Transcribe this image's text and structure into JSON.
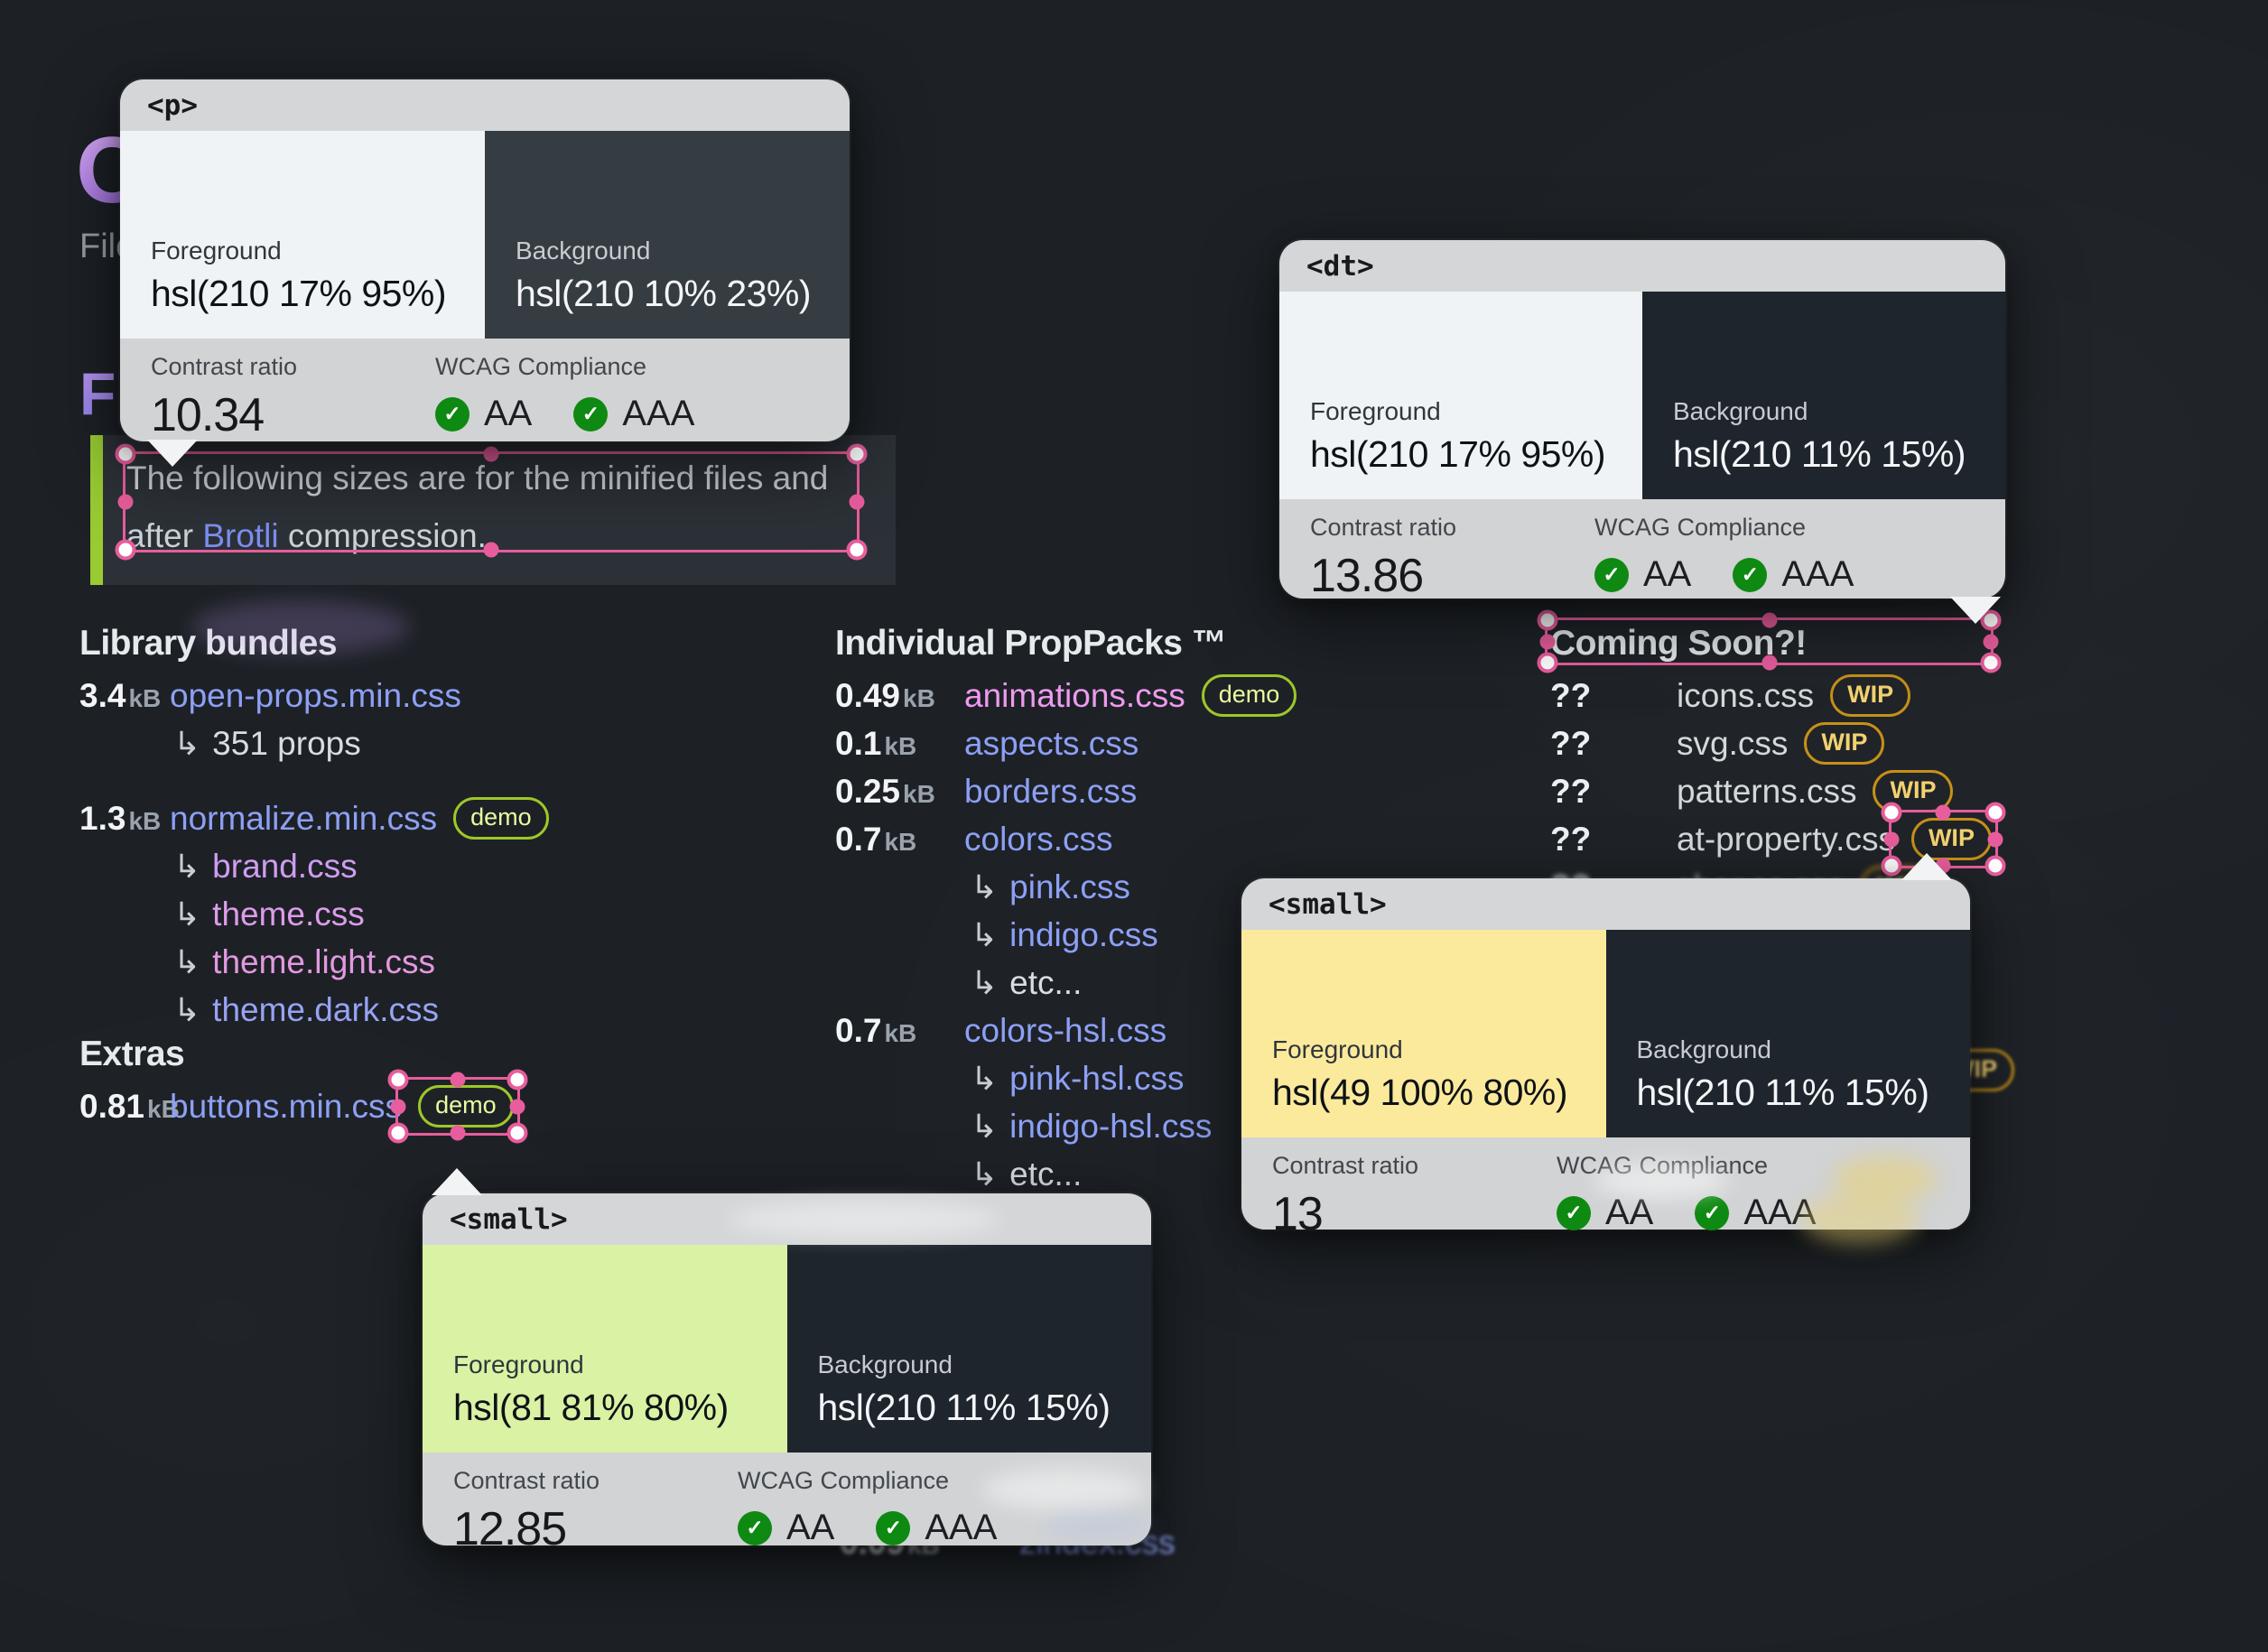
{
  "hero": {
    "big_letter": "O",
    "clipped_word": "File",
    "clipped_heading": "Fi"
  },
  "note": {
    "line1": "The following sizes are for the minified files and",
    "line2_before": "after ",
    "line2_link": "Brotli",
    "line2_after": " compression."
  },
  "columns": {
    "library": {
      "heading": "Library bundles",
      "rows": [
        {
          "size": "3.4",
          "unit": "kB",
          "name": "open-props.min.css"
        },
        {
          "arrow": "↳",
          "name": "351 props"
        },
        {
          "size": "1.3",
          "unit": "kB",
          "name": "normalize.min.css",
          "badge": "demo"
        },
        {
          "arrow": "↳",
          "name": "brand.css"
        },
        {
          "arrow": "↳",
          "name": "theme.css"
        },
        {
          "arrow": "↳",
          "name": "theme.light.css"
        },
        {
          "arrow": "↳",
          "name": "theme.dark.css"
        }
      ]
    },
    "extras": {
      "heading": "Extras",
      "rows": [
        {
          "size": "0.81",
          "unit": "kB",
          "name": "buttons.min.css",
          "badge": "demo"
        }
      ]
    },
    "packs": {
      "heading": "Individual PropPacks ™",
      "rows": [
        {
          "size": "0.49",
          "unit": "kB",
          "name": "animations.css",
          "badge": "demo"
        },
        {
          "size": "0.1",
          "unit": "kB",
          "name": "aspects.css"
        },
        {
          "size": "0.25",
          "unit": "kB",
          "name": "borders.css"
        },
        {
          "size": "0.7",
          "unit": "kB",
          "name": "colors.css"
        },
        {
          "arrow": "↳",
          "name": "pink.css"
        },
        {
          "arrow": "↳",
          "name": "indigo.css"
        },
        {
          "arrow": "↳",
          "name": "etc..."
        },
        {
          "size": "0.7",
          "unit": "kB",
          "name": "colors-hsl.css"
        },
        {
          "arrow": "↳",
          "name": "pink-hsl.css"
        },
        {
          "arrow": "↳",
          "name": "indigo-hsl.css"
        },
        {
          "arrow": "↳",
          "name": "etc..."
        }
      ]
    },
    "coming_soon": {
      "heading": "Coming Soon?!",
      "rows": [
        {
          "q": "??",
          "name": "icons.css",
          "badge": "WIP"
        },
        {
          "q": "??",
          "name": "svg.css",
          "badge": "WIP"
        },
        {
          "q": "??",
          "name": "patterns.css",
          "badge": "WIP"
        },
        {
          "q": "??",
          "name": "at-property.css",
          "badge": "WIP"
        },
        {
          "q": "??",
          "name": "shapes.css",
          "badge": "WIP"
        }
      ]
    },
    "hidden_row": {
      "size": "0.09",
      "unit": "kB",
      "name": "zindex.css"
    },
    "hidden_badge": "WIP"
  },
  "tooltips": [
    {
      "tag": "<p>",
      "foreground_label": "Foreground",
      "foreground": "hsl(210 17% 95%)",
      "fg_hex": "#f0f3f6",
      "background_label": "Background",
      "background": "hsl(210 10% 23%)",
      "bg_hex": "#353c42",
      "contrast_label": "Contrast ratio",
      "contrast": "10.34",
      "wcag_label": "WCAG Compliance",
      "aa": "AA",
      "aaa": "AAA",
      "check": "✓"
    },
    {
      "tag": "<dt>",
      "foreground_label": "Foreground",
      "foreground": "hsl(210 17% 95%)",
      "fg_hex": "#f0f3f6",
      "background_label": "Background",
      "background": "hsl(210 11% 15%)",
      "bg_hex": "#1e252d",
      "contrast_label": "Contrast ratio",
      "contrast": "13.86",
      "wcag_label": "WCAG Compliance",
      "aa": "AA",
      "aaa": "AAA",
      "check": "✓"
    },
    {
      "tag": "<small>",
      "foreground_label": "Foreground",
      "foreground": "hsl(49 100% 80%)",
      "fg_hex": "#fcea9c",
      "background_label": "Background",
      "background": "hsl(210 11% 15%)",
      "bg_hex": "#1e252d",
      "contrast_label": "Contrast ratio",
      "contrast": "13",
      "wcag_label": "WCAG Compliance",
      "aa": "AA",
      "aaa": "AAA",
      "check": "✓"
    },
    {
      "tag": "<small>",
      "foreground_label": "Foreground",
      "foreground": "hsl(81 81% 80%)",
      "fg_hex": "#d9f2a4",
      "background_label": "Background",
      "background": "hsl(210 11% 15%)",
      "bg_hex": "#1e252d",
      "contrast_label": "Contrast ratio",
      "contrast": "12.85",
      "wcag_label": "WCAG Compliance",
      "aa": "AA",
      "aaa": "AAA",
      "check": "✓"
    }
  ],
  "colors": {
    "selection_pink": "#e85d9d",
    "link_indigo": "#8da0f5",
    "badge_demo_border": "#9ec72a",
    "badge_demo_text": "#e9fb9f",
    "badge_wip_border": "#c79018",
    "badge_wip_text": "#f3d26f",
    "check_green": "#0e8912",
    "note_accent_green": "#98ca32"
  }
}
